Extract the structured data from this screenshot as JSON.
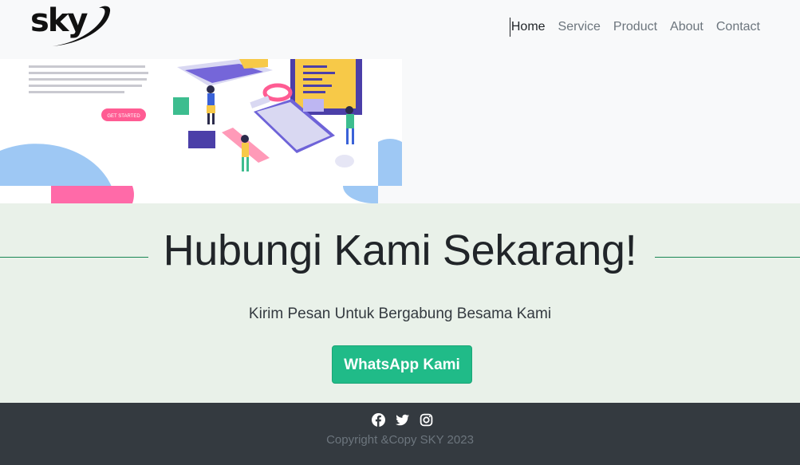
{
  "brand": {
    "logo_text": "sky"
  },
  "nav": {
    "items": [
      {
        "label": "Home",
        "active": true
      },
      {
        "label": "Service",
        "active": false
      },
      {
        "label": "Product",
        "active": false
      },
      {
        "label": "About",
        "active": false
      },
      {
        "label": "Contact",
        "active": false
      }
    ]
  },
  "hero": {
    "cta_label": "GET STARTED"
  },
  "contact": {
    "title": "Hubungi Kami Sekarang!",
    "subtitle": "Kirim Pesan Untuk Bergabung Besama Kami",
    "button_label": "WhatsApp Kami"
  },
  "footer": {
    "social_icons": [
      "facebook-icon",
      "twitter-icon",
      "instagram-icon"
    ],
    "copyright": "Copyright &Copy SKY 2023"
  },
  "colors": {
    "accent_green": "#20bb88",
    "footer_bg": "#343a40",
    "contact_bg": "#e9f1e9",
    "line_green": "#198754"
  }
}
